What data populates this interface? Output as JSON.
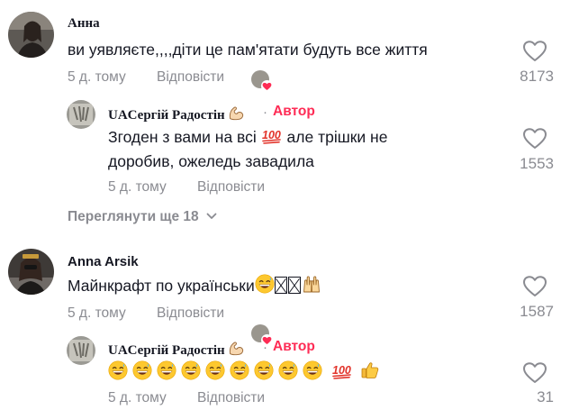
{
  "comments": [
    {
      "author": "Анна",
      "text": "ви уявляєте,,,,діти це пам'ятати будуть все життя",
      "time": "5 д. тому",
      "reply_label": "Відповісти",
      "likes": "8173"
    },
    {
      "author": "UAСергій Радостін",
      "author_badge": "Автор",
      "text_1": "Згоден з вами на всі",
      "text_2": "але трішки не",
      "text_3": "доробив, ожеледь завадила",
      "time": "5 д. тому",
      "reply_label": "Відповісти",
      "likes": "1553"
    },
    {
      "view_more": "Переглянути ще 18"
    },
    {
      "author": "Anna Arsik",
      "text": "Майнкрафт по українськи",
      "time": "5 д. тому",
      "reply_label": "Відповісти",
      "likes": "1587"
    },
    {
      "author": "UAСергій Радостін",
      "author_badge": "Автор",
      "time": "5 д. тому",
      "reply_label": "Відповісти",
      "likes": "31"
    }
  ],
  "icons": {
    "heart": "heart-outline-icon",
    "hundred": "hundred-points-emoji",
    "muscle": "flexed-biceps-emoji",
    "grin": "grinning-sweat-emoji",
    "thumbs": "thumbs-up-emoji",
    "raised_hands": "raising-hands-emoji",
    "chevron": "chevron-down-icon"
  },
  "colors": {
    "author_badge": "#fe2c55",
    "meta": "#8a8b91",
    "text": "#161823"
  }
}
